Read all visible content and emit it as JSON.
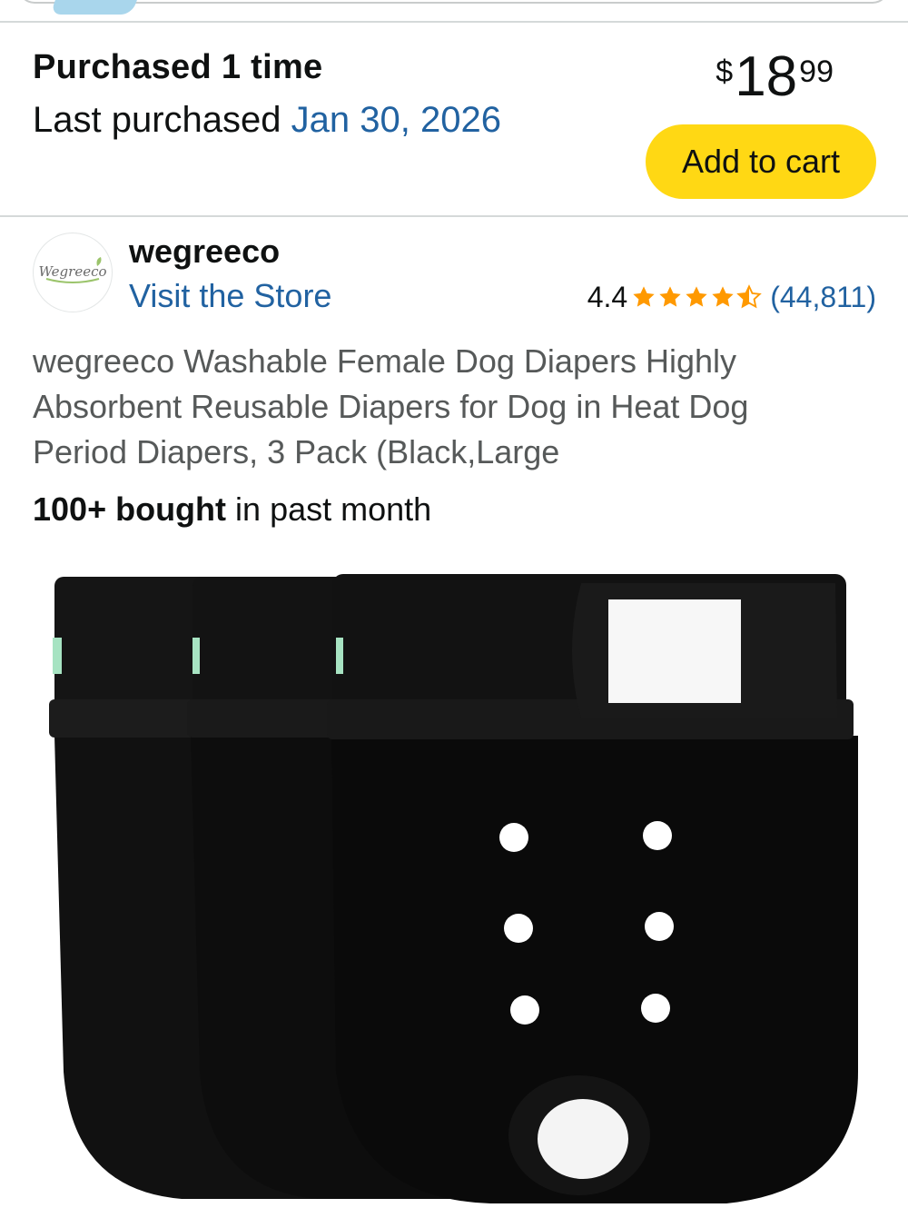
{
  "purchase": {
    "count_text": "Purchased 1 time",
    "last_label": "Last purchased",
    "last_date": "Jan 30, 2026"
  },
  "price": {
    "currency": "$",
    "whole": "18",
    "fraction": "99"
  },
  "add_to_cart_label": "Add to cart",
  "store": {
    "logo_text": "Wegreeco",
    "name": "wegreeco",
    "visit_label": "Visit the Store"
  },
  "rating": {
    "value": "4.4",
    "stars": 4.4,
    "count": "(44,811)"
  },
  "product": {
    "title": "wegreeco Washable Female Dog Diapers Highly Absorbent Reusable Diapers for Dog in Heat Dog Period Diapers, 3 Pack (Black,Large",
    "bought_bold": "100+ bought",
    "bought_rest": "in past month",
    "image_icon": "black-dog-diapers-3-pack-image"
  },
  "colors": {
    "accent_link": "#2162a1",
    "button_yellow": "#ffd814",
    "star_orange": "#ff9900"
  }
}
